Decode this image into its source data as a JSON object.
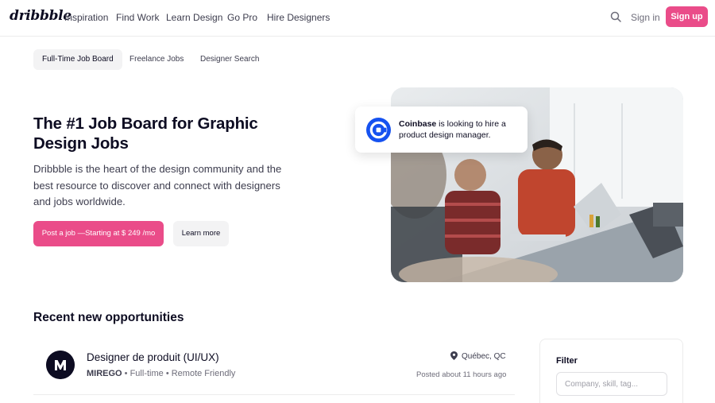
{
  "nav": {
    "logo": "dribbble",
    "links": [
      "Inspiration",
      "Find Work",
      "Learn Design",
      "Go Pro",
      "Hire Designers"
    ],
    "signin": "Sign in",
    "signup": "Sign up"
  },
  "tabs": [
    "Full-Time Job Board",
    "Freelance Jobs",
    "Designer Search"
  ],
  "hero": {
    "title": "The #1 Job Board for Graphic Design Jobs",
    "description": "Dribbble is the heart of the design community and the best resource to discover and connect with designers and jobs worldwide.",
    "primary_button": "Post a job —Starting at $ 249 /mo",
    "secondary_button": "Learn more",
    "hire_card": {
      "company": "Coinbase",
      "text": " is looking to hire a product design manager."
    }
  },
  "opportunities": {
    "title": "Recent new opportunities",
    "jobs": [
      {
        "title": "Designer de produit (UI/UX)",
        "company": "MIREGO",
        "details": " • Full-time • Remote Friendly",
        "location": "Québec, QC",
        "posted": "Posted about 11 hours ago"
      }
    ]
  },
  "filter": {
    "title": "Filter",
    "placeholder": "Company, skill, tag..."
  },
  "colors": {
    "brand": "#ea4c89",
    "text": "#0d0c22",
    "coinbase": "#1652f0"
  }
}
